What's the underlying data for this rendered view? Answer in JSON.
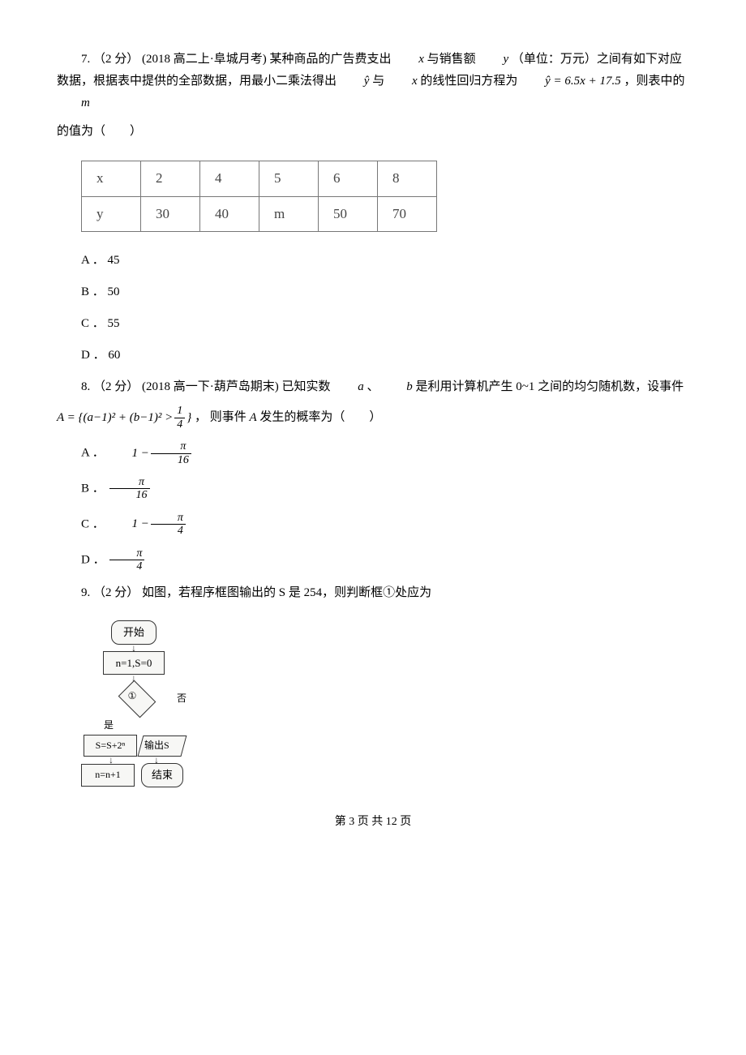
{
  "q7": {
    "prefix": "7. （2 分） (2018 高二上·阜城月考) 某种商品的广告费支出 ",
    "var_x": "x",
    "mid1": " 与销售额 ",
    "var_y": "y",
    "mid2": " （单位：万元）之间有如下对应数据，根据表中提供的全部数据，用最小二乘法得出 ",
    "yhat": "ŷ",
    "mid3": " 与 ",
    "var_x2": "x",
    "mid4": " 的线性回归方程为 ",
    "eq": "ŷ = 6.5x + 17.5",
    "mid5": " ，则表中的 ",
    "var_m": "m",
    "tail": " 的值为（　　）",
    "table": {
      "row1": [
        "x",
        "2",
        "4",
        "5",
        "6",
        "8"
      ],
      "row2": [
        "y",
        "30",
        "40",
        "m",
        "50",
        "70"
      ]
    },
    "options": {
      "A": "A ． 45",
      "B": "B ． 50",
      "C": "C ． 55",
      "D": "D ． 60"
    }
  },
  "q8": {
    "prefix": "8. （2 分） (2018 高一下·葫芦岛期末) 已知实数 ",
    "var_a": "a",
    "sep1": "、",
    "var_b": "b",
    "mid1": " 是利用计算机产生 0~1 之间的均匀随机数，设事件",
    "formula_lhs": "A = {(a−1)² + (b−1)² > ",
    "formula_frac_num": "1",
    "formula_frac_den": "4",
    "formula_rhs": "}",
    "mid2": " ， 则事件 ",
    "var_A": "A",
    "tail": " 发生的概率为（　　）",
    "options": {
      "A": {
        "label": "A ．",
        "one_minus": "1 − ",
        "num": "π",
        "den": "16"
      },
      "B": {
        "label": "B ．",
        "num": "π",
        "den": "16"
      },
      "C": {
        "label": "C ．",
        "one_minus": "1 − ",
        "num": "π",
        "den": "4"
      },
      "D": {
        "label": "D ．",
        "num": "π",
        "den": "4"
      }
    }
  },
  "q9": {
    "text": "9. （2 分）  如图，若程序框图输出的 S 是 254，则判断框①处应为",
    "flowchart": {
      "start": "开始",
      "init": "n=1,S=0",
      "decision": "①",
      "no": "否",
      "yes": "是",
      "step": "S=S+2ⁿ",
      "output": "输出S",
      "inc": "n=n+1",
      "end": "结束"
    }
  },
  "footer": "第 3 页 共 12 页"
}
